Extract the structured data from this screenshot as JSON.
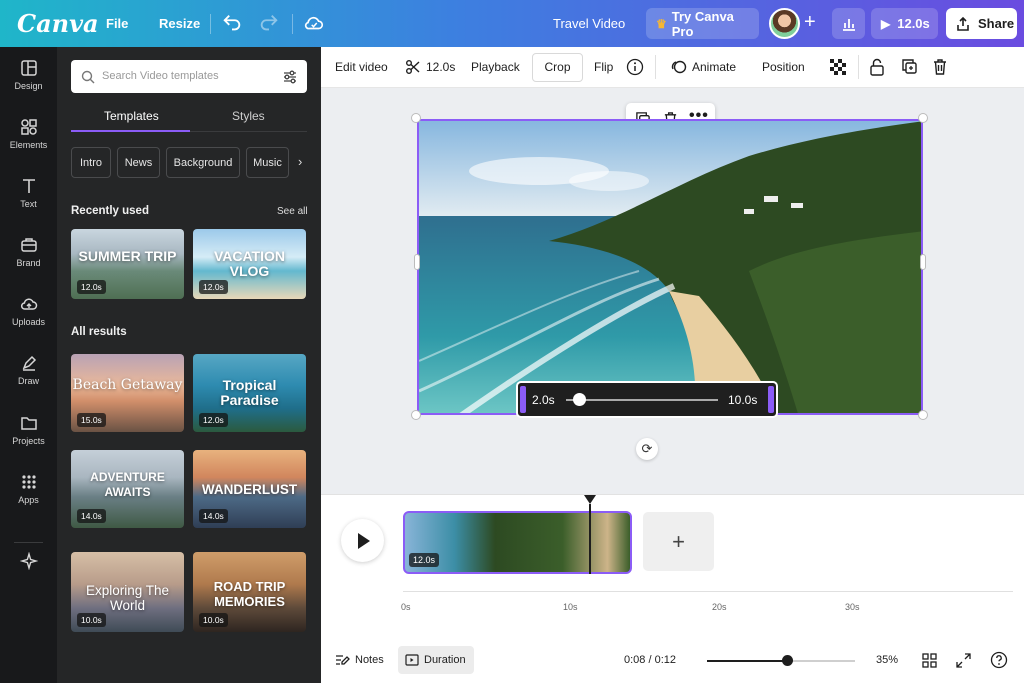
{
  "topbar": {
    "logo": "Canva",
    "file": "File",
    "resize": "Resize",
    "title": "Travel Video",
    "try_pro": "Try Canva Pro",
    "play_duration": "12.0s",
    "share": "Share"
  },
  "rail": [
    "Design",
    "Elements",
    "Text",
    "Brand",
    "Uploads",
    "Draw",
    "Projects",
    "Apps"
  ],
  "panel": {
    "search_placeholder": "Search Video templates",
    "tabs": [
      "Templates",
      "Styles"
    ],
    "chips": [
      "Intro",
      "News",
      "Background",
      "Music"
    ],
    "recent_heading": "Recently used",
    "see_all": "See all",
    "recent": [
      {
        "title": "SUMMER TRIP",
        "dur": "12.0s"
      },
      {
        "title": "VACATION VLOG",
        "dur": "12.0s"
      }
    ],
    "all_heading": "All results",
    "results": [
      {
        "title": "Beach Getaway",
        "dur": "15.0s"
      },
      {
        "title": "Tropical Paradise",
        "dur": "12.0s"
      },
      {
        "title": "ADVENTURE AWAITS",
        "dur": "14.0s"
      },
      {
        "title": "WANDERLUST",
        "dur": "14.0s"
      },
      {
        "title": "Exploring The World",
        "dur": "10.0s"
      },
      {
        "title": "ROAD TRIP MEMORIES",
        "dur": "10.0s"
      }
    ]
  },
  "toolbar": {
    "edit_video": "Edit video",
    "duration": "12.0s",
    "playback": "Playback",
    "crop": "Crop",
    "flip": "Flip",
    "animate": "Animate",
    "position": "Position"
  },
  "trim": {
    "start": "2.0s",
    "end": "10.0s"
  },
  "timeline": {
    "clip_duration": "12.0s",
    "ticks": [
      "0s",
      "10s",
      "20s",
      "30s"
    ],
    "notes": "Notes",
    "duration_btn": "Duration",
    "time": "0:08 / 0:12",
    "zoom": "35%",
    "zoom_level": 0.54
  }
}
